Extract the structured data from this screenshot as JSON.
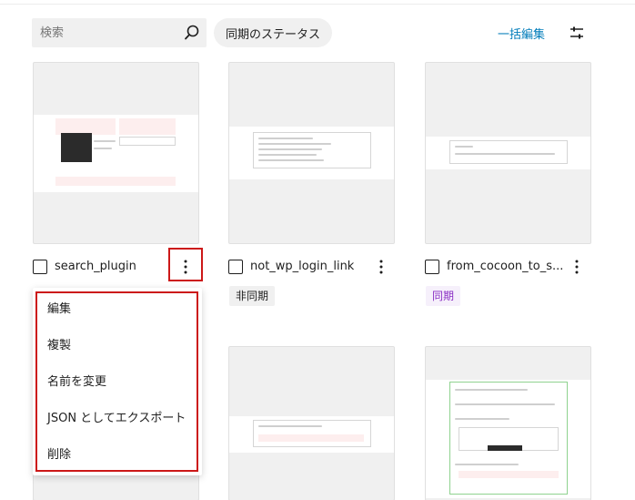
{
  "toolbar": {
    "search_placeholder": "検索",
    "status_filter_label": "同期のステータス",
    "bulk_edit_label": "一括編集"
  },
  "cards": [
    {
      "title": "search_plugin"
    },
    {
      "title": "not_wp_login_link",
      "badge": "非同期"
    },
    {
      "title": "from_cocoon_to_s...",
      "badge": "同期"
    }
  ],
  "context_menu": {
    "items": [
      "編集",
      "複製",
      "名前を変更",
      "JSON としてエクスポート",
      "削除"
    ]
  },
  "colors": {
    "accent": "#007cba",
    "highlight": "#cc1818",
    "synced_badge_text": "#8a2ec4"
  },
  "icons": [
    "search-icon",
    "sliders-icon",
    "more-vertical-icon"
  ]
}
